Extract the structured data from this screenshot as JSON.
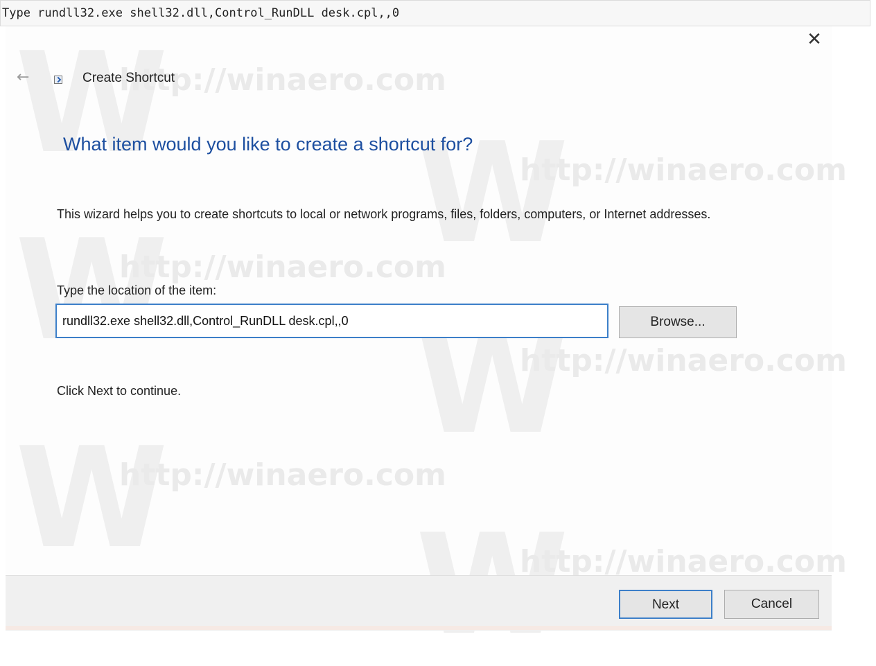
{
  "caption": "Type rundll32.exe shell32.dll,Control_RunDLL desk.cpl,,0",
  "window": {
    "title": "Create Shortcut",
    "close_glyph": "✕",
    "back_glyph": "←",
    "icons": [
      "close-icon",
      "back-arrow-icon",
      "shortcut-icon"
    ]
  },
  "wizard": {
    "heading": "What item would you like to create a shortcut for?",
    "description": "This wizard helps you to create shortcuts to local or network programs, files, folders, computers, or Internet addresses.",
    "location_label": "Type the location of the item:",
    "location_value": "rundll32.exe shell32.dll,Control_RunDLL desk.cpl,,0",
    "browse_label": "Browse...",
    "continue_text": "Click Next to continue."
  },
  "footer": {
    "next_label": "Next",
    "cancel_label": "Cancel"
  },
  "watermark": {
    "letter": "W",
    "text": "http://winaero.com"
  },
  "colors": {
    "heading": "#1d4fa0",
    "focus_border": "#3c7fc9",
    "footer_bg": "#f0f0f0"
  }
}
